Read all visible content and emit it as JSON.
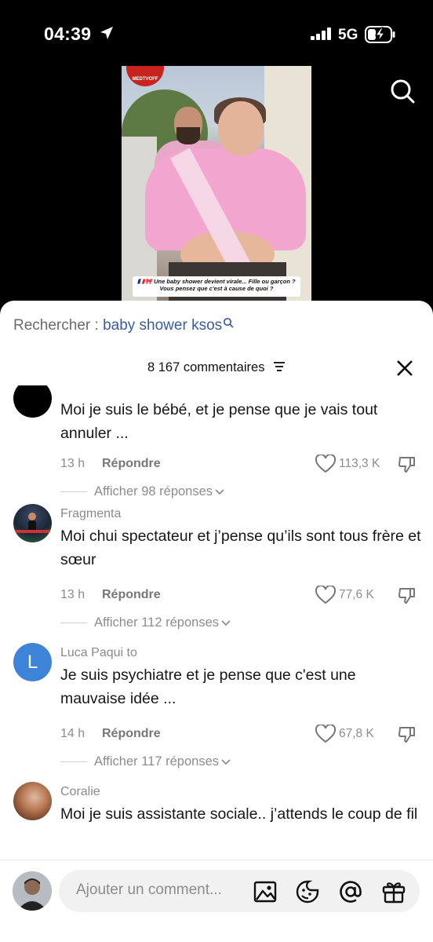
{
  "status_bar": {
    "time": "04:39",
    "network": "5G"
  },
  "video": {
    "logo_text": "MEDTVOFF",
    "caption": "🇫🇷🎀 Une baby shower devient virale... Fille ou garçon ? Vous pensez que c'est à cause de quoi ?"
  },
  "search": {
    "label": "Rechercher :",
    "term": "baby shower ksos"
  },
  "comments_header": {
    "count_label": "8 167 commentaires"
  },
  "comments": [
    {
      "username": "",
      "text": "Moi je suis le bébé, et je pense que je vais tout annuler ...",
      "age": "13 h",
      "reply_label": "Répondre",
      "likes": "113,3 K",
      "replies_label": "Afficher 98 réponses"
    },
    {
      "username": "Fragmenta",
      "text": "Moi chui spectateur et j’pense qu’ils sont tous frère et sœur",
      "age": "13 h",
      "reply_label": "Répondre",
      "likes": "77,6 K",
      "replies_label": "Afficher 112 réponses"
    },
    {
      "username": "Luca Paqui to",
      "avatar_letter": "L",
      "text": "Je suis psychiatre et je pense que c'est une mauvaise idée ...",
      "age": "14 h",
      "reply_label": "Répondre",
      "likes": "67,8 K",
      "replies_label": "Afficher 117 réponses"
    },
    {
      "username": "Coralie",
      "text": "Moi je suis assistante sociale.. j’attends le coup de fil"
    }
  ],
  "composer": {
    "placeholder": "Ajouter un comment..."
  },
  "colors": {
    "accent_link": "#3a5c9e",
    "avatar_blue": "#3d83d8"
  },
  "icons": [
    "location-arrow-icon",
    "signal-icon",
    "battery-charging-icon",
    "search-icon",
    "sort-icon",
    "close-icon",
    "heart-icon",
    "dislike-icon",
    "chevron-down-icon",
    "image-icon",
    "emoji-icon",
    "at-icon",
    "gift-icon"
  ]
}
